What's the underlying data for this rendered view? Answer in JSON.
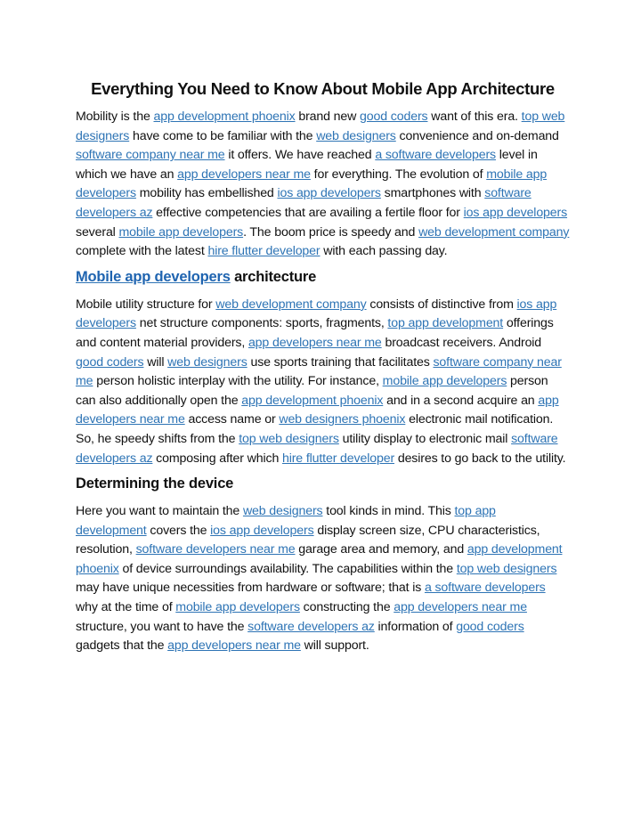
{
  "document": {
    "title": "Everything You Need to Know About Mobile App Architecture",
    "link_color": "#2e74b5",
    "paragraphs": [
      {
        "segments": [
          {
            "t": "Mobility is the "
          },
          {
            "link": "app development phoenix"
          },
          {
            "t": " brand new "
          },
          {
            "link": "good coders"
          },
          {
            "t": " want of this era. "
          },
          {
            "link": "top web designers"
          },
          {
            "t": " have come to be familiar with the "
          },
          {
            "link": "web designers"
          },
          {
            "t": " convenience and on-demand  "
          },
          {
            "link": "software company near me"
          },
          {
            "t": " it offers. We have reached "
          },
          {
            "link": "a software developers"
          },
          {
            "t": " level in which we have an "
          },
          {
            "link": "app developers near me"
          },
          {
            "t": " for everything. The evolution of "
          },
          {
            "link": "mobile app developers"
          },
          {
            "t": " mobility has embellished "
          },
          {
            "link": "ios app developers"
          },
          {
            "t": " smartphones with "
          },
          {
            "link": "software developers az"
          },
          {
            "t": " effective competencies that are availing a fertile floor for "
          },
          {
            "link": "ios app developers"
          },
          {
            "t": " several "
          },
          {
            "link": "mobile app developers"
          },
          {
            "t": ". The boom price is speedy and "
          },
          {
            "link": "web development company"
          },
          {
            "t": " complete with the latest "
          },
          {
            "link": "hire flutter developer"
          },
          {
            "t": " with each passing day."
          }
        ]
      }
    ],
    "sections": [
      {
        "heading": [
          {
            "link": "Mobile app developers"
          },
          {
            "t": " architecture"
          }
        ],
        "segments": [
          {
            "t": "Mobile utility structure for "
          },
          {
            "link": "web development company"
          },
          {
            "t": " consists of distinctive from "
          },
          {
            "link": "ios app developers"
          },
          {
            "t": " net structure components: sports, fragments, "
          },
          {
            "link": "top app development"
          },
          {
            "t": " offerings and content material providers, "
          },
          {
            "link": "app developers near me"
          },
          {
            "t": " broadcast receivers.  Android "
          },
          {
            "link": "good coders"
          },
          {
            "t": " will "
          },
          {
            "link": "web designers"
          },
          {
            "t": " use sports training that facilitates "
          },
          {
            "link": "software company near me"
          },
          {
            "t": " person holistic interplay with the utility. For instance, "
          },
          {
            "link": "mobile app developers"
          },
          {
            "t": " person can also additionally open the "
          },
          {
            "link": "app development phoenix"
          },
          {
            "t": " and in a second acquire an "
          },
          {
            "link": "app developers near me"
          },
          {
            "t": " access name or "
          },
          {
            "link": "web designers phoenix"
          },
          {
            "t": " electronic mail notification. So, he speedy shifts from the "
          },
          {
            "link": "top web designers"
          },
          {
            "t": " utility display to electronic mail "
          },
          {
            "link": "software developers az"
          },
          {
            "t": " composing after which "
          },
          {
            "link": "hire flutter developer"
          },
          {
            "t": " desires to go back to the utility."
          }
        ]
      },
      {
        "heading": [
          {
            "t": "Determining the device"
          }
        ],
        "segments": [
          {
            "t": "Here you want to maintain the "
          },
          {
            "link": "web designers"
          },
          {
            "t": " tool kinds in mind. This "
          },
          {
            "link": "top app development"
          },
          {
            "t": " covers the "
          },
          {
            "link": "ios app developers"
          },
          {
            "t": " display screen size, CPU characteristics, resolution, "
          },
          {
            "link": "software developers near me"
          },
          {
            "t": " garage area and memory, and "
          },
          {
            "link": "app development phoenix"
          },
          {
            "t": " of device surroundings availability. The capabilities within the "
          },
          {
            "link": "top web designers"
          },
          {
            "t": " may have unique necessities from hardware or software; that is "
          },
          {
            "link": "a software developers"
          },
          {
            "t": " why at the time of "
          },
          {
            "link": "mobile app developers"
          },
          {
            "t": " constructing the "
          },
          {
            "link": "app developers near me"
          },
          {
            "t": " structure, you want to have the "
          },
          {
            "link": "software developers az"
          },
          {
            "t": " information of "
          },
          {
            "link": "good coders"
          },
          {
            "t": " gadgets that the "
          },
          {
            "link": "app developers near me"
          },
          {
            "t": " will support."
          }
        ]
      }
    ]
  }
}
